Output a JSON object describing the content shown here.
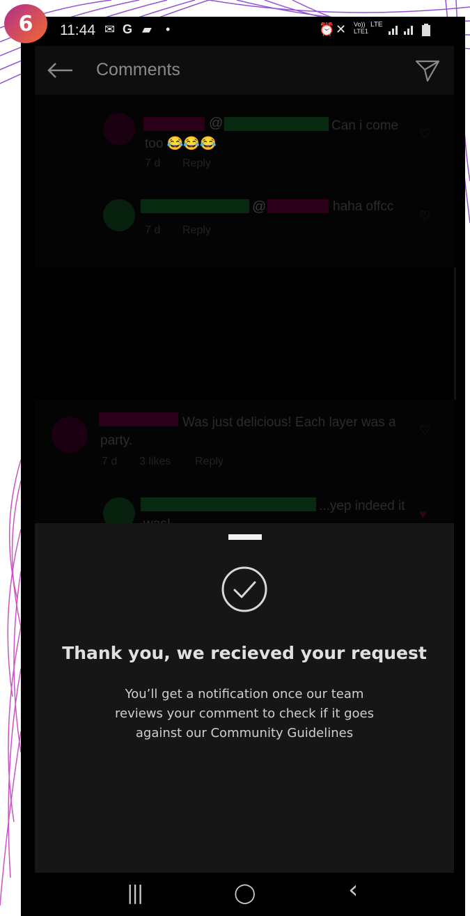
{
  "step_badge": "6",
  "status_bar": {
    "time": "11:44",
    "left_icons": [
      "message-icon",
      "google-icon",
      "chat-icon",
      "dot-icon"
    ],
    "right_icons": [
      "alarm-icon",
      "mute-icon",
      "volte-icon",
      "lte-icon",
      "signal-icon",
      "signal-icon",
      "battery-icon"
    ],
    "volte_label": "Vo)) LTE1",
    "lte_label": "LTE"
  },
  "header": {
    "title": "Comments",
    "back_icon": "back-arrow-icon",
    "share_icon": "send-icon"
  },
  "comments": [
    {
      "text": "Can i come too 😂😂😂",
      "mention_symbol": "@",
      "time": "7 d",
      "reply": "Reply",
      "likes": ""
    },
    {
      "text": "haha offcc",
      "mention_symbol": "@",
      "time": "7 d",
      "reply": "Reply",
      "likes": ""
    },
    {
      "text": "Was just delicious! Each layer was a party.",
      "time": "7 d",
      "likes": "3 likes",
      "reply": "Reply"
    },
    {
      "text": "...yep indeed it was!"
    }
  ],
  "sheet": {
    "title": "Thank you, we recieved your request",
    "body": "You’ll get a notification once our team reviews your comment to check if it goes against our Community Guidelines",
    "icon": "check-circle-icon"
  },
  "nav": {
    "recents_glyph": "|||",
    "home_glyph": "◯",
    "back_glyph": "‹"
  },
  "colors": {
    "sheet_bg": "#161616",
    "badge_gradient_start": "#b02e8f",
    "badge_gradient_end": "#f26a2d",
    "decor_line": "#8a3fd1"
  }
}
